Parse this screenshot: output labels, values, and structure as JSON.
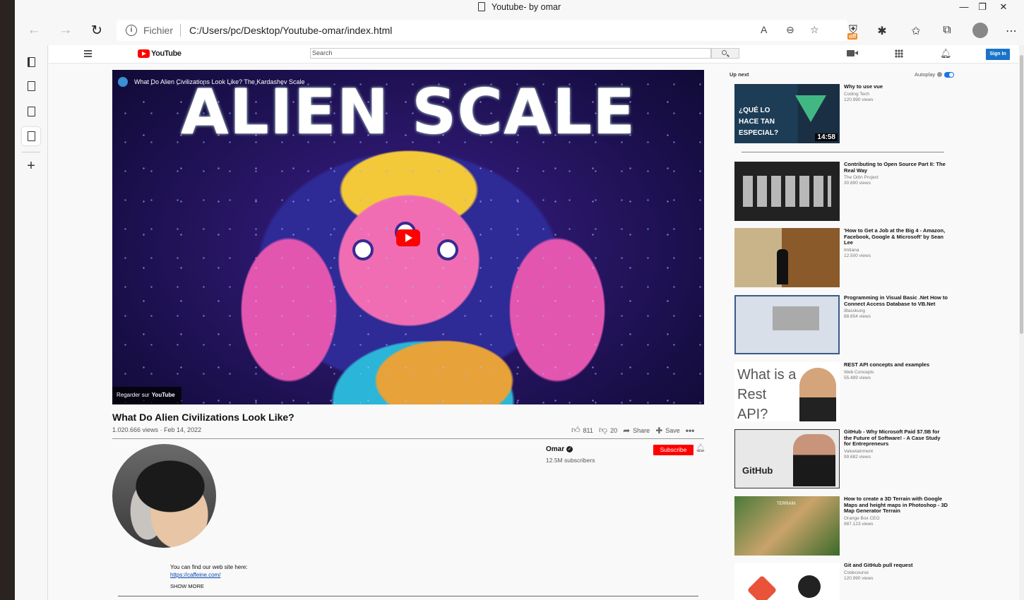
{
  "browser": {
    "window_title": "Youtube- by omar",
    "address_scheme": "Fichier",
    "address_url": "C:/Users/pc/Desktop/Youtube-omar/index.html",
    "extension_badge": "off"
  },
  "header": {
    "logo_text": "YouTube",
    "search_placeholder": "Search",
    "signin_label": "Sign In"
  },
  "player": {
    "embed_title": "What Do Alien Civilizations Look Like? The Kardashev Scale",
    "thumbnail_text": "ALIEN SCALE",
    "watch_on_prefix": "Regarder sur",
    "watch_on_brand": "YouTube"
  },
  "video": {
    "title": "What Do Alien Civilizations Look Like?",
    "meta": "1.020.666 views · Feb 14, 2022",
    "likes": "811",
    "dislikes": "20",
    "share_label": "Share",
    "save_label": "Save"
  },
  "channel": {
    "name": "Omar",
    "subscribers": "12.5M subscribers",
    "subscribe_label": "Subscribe",
    "description_line": "You can find our web site here:",
    "description_link": "https://caffeine.com/",
    "show_more": "SHOW MORE"
  },
  "sidebar": {
    "up_next_label": "Up next",
    "autoplay_label": "Autoplay",
    "recommendations": [
      {
        "title": "Why to use vue",
        "channel": "Coding Tech",
        "views": "120.990 views",
        "duration": "14:58",
        "thumb_text": "¿QUÉ LO HACE TAN ESPECIAL?"
      },
      {
        "title": "Contributing to Open Source Part II: The Real Way",
        "channel": "The Odin Project",
        "views": "30.890 views"
      },
      {
        "title": "'How to Get a Job at the Big 4 - Amazon, Facebook, Google & Microsoft' by Sean Lee",
        "channel": "Imtiana",
        "views": "12.500 views"
      },
      {
        "title": "Programming in Visual Basic .Net How to Connect Access Database to VB.Net",
        "channel": "iBasskung",
        "views": "88.654 views"
      },
      {
        "title": "REST API concepts and examples",
        "channel": "Web Concepts",
        "views": "55.489 views",
        "thumb_text": "What is a Rest API?"
      },
      {
        "title": "GitHub - Why Microsoft Paid $7.5B for the Future of Software! - A Case Study for Entrepreneurs",
        "channel": "Valuetainment",
        "views": "99.682 views",
        "thumb_text": "GitHub"
      },
      {
        "title": "How to create a 3D Terrain with Google Maps and height maps in Photoshop - 3D Map Generator Terrain",
        "channel": "Orange Box CEO",
        "views": "987.123 views",
        "thumb_text": "TERRAIN"
      },
      {
        "title": "Git and GitHub pull request",
        "channel": "Codecourse",
        "views": "120.990 views"
      }
    ]
  }
}
